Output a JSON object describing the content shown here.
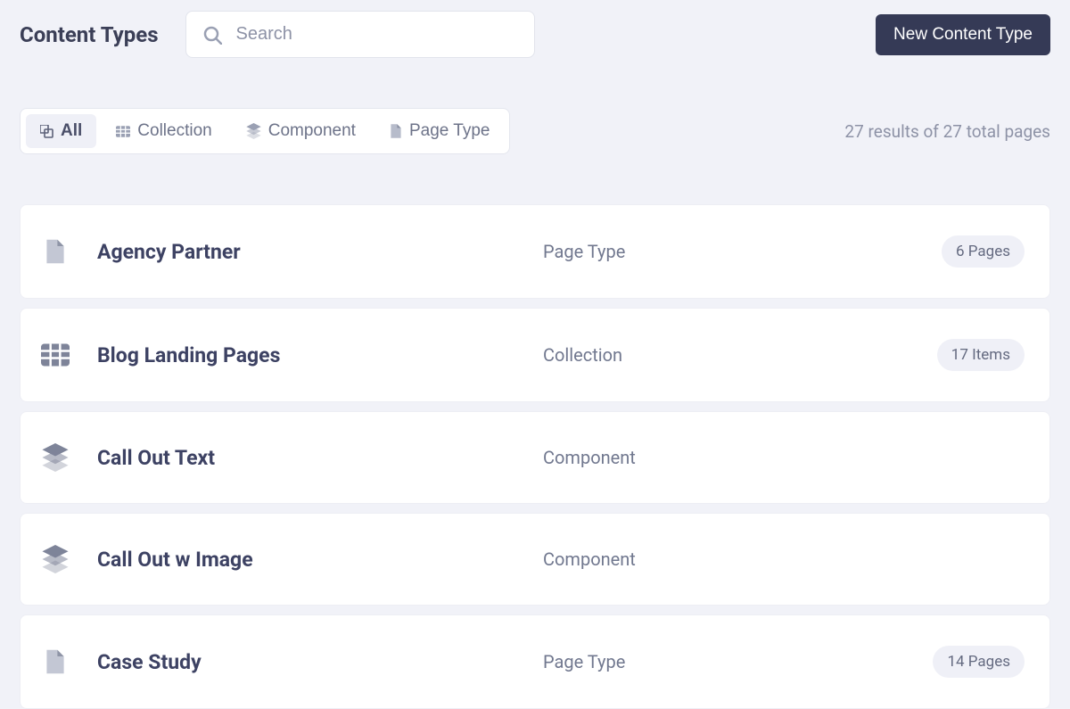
{
  "header": {
    "title": "Content Types",
    "search_placeholder": "Search",
    "new_button": "New Content Type"
  },
  "filters": {
    "all": "All",
    "collection": "Collection",
    "component": "Component",
    "page_type": "Page Type"
  },
  "results_text": "27 results of 27 total pages",
  "rows": [
    {
      "title": "Agency Partner",
      "kind": "Page Type",
      "badge": "6 Pages",
      "icon": "page"
    },
    {
      "title": "Blog Landing Pages",
      "kind": "Collection",
      "badge": "17 Items",
      "icon": "collection"
    },
    {
      "title": "Call Out Text",
      "kind": "Component",
      "badge": "",
      "icon": "component"
    },
    {
      "title": "Call Out w Image",
      "kind": "Component",
      "badge": "",
      "icon": "component"
    },
    {
      "title": "Case Study",
      "kind": "Page Type",
      "badge": "14 Pages",
      "icon": "page"
    }
  ]
}
